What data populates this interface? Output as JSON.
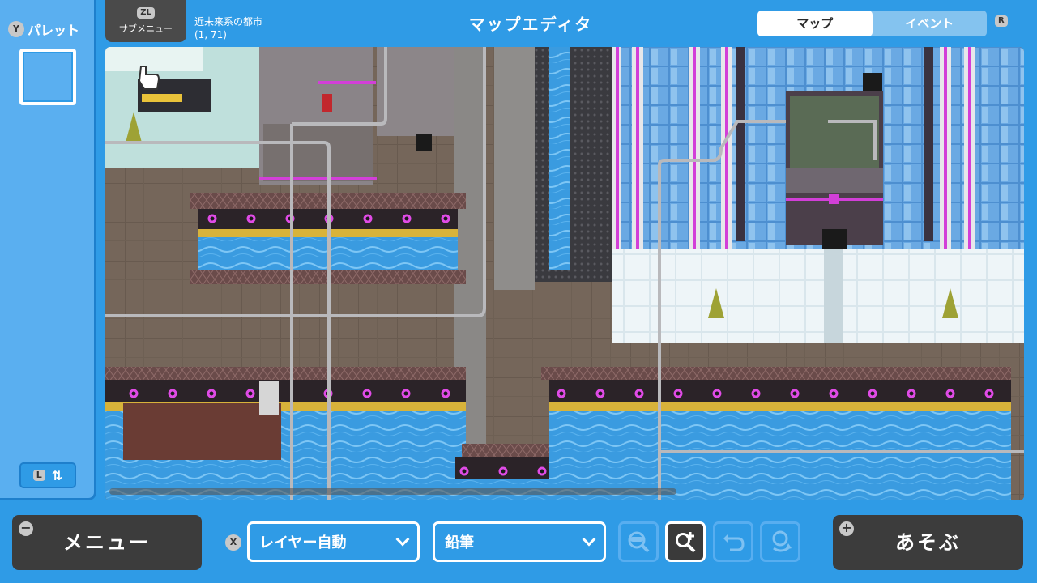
{
  "header": {
    "submenu_button": "ZL",
    "submenu_label": "サブメニュー",
    "map_name": "近未来系の都市",
    "coords": "(1, 71)",
    "title": "マップエディタ",
    "tabs": [
      {
        "label": "マップ",
        "active": true
      },
      {
        "label": "イベント",
        "active": false
      }
    ],
    "next_tab_button": "R"
  },
  "palette": {
    "button": "Y",
    "label": "パレット",
    "toggle_button": "L"
  },
  "bottom": {
    "menu_label": "メニュー",
    "menu_button": "−",
    "layer_button": "X",
    "layer_select": "レイヤー自動",
    "tool_select": "鉛筆",
    "play_label": "あそぶ",
    "play_button": "+"
  },
  "icons": {
    "tools": [
      "eyedropper-icon",
      "magnify-plus-icon",
      "undo-icon",
      "redo-icon"
    ]
  },
  "colors": {
    "background": "#2f9be6",
    "panel": "#5aaff0",
    "button_dark": "#3c3c3c",
    "water": "#3a9be0",
    "neon": "#d23fd8"
  }
}
